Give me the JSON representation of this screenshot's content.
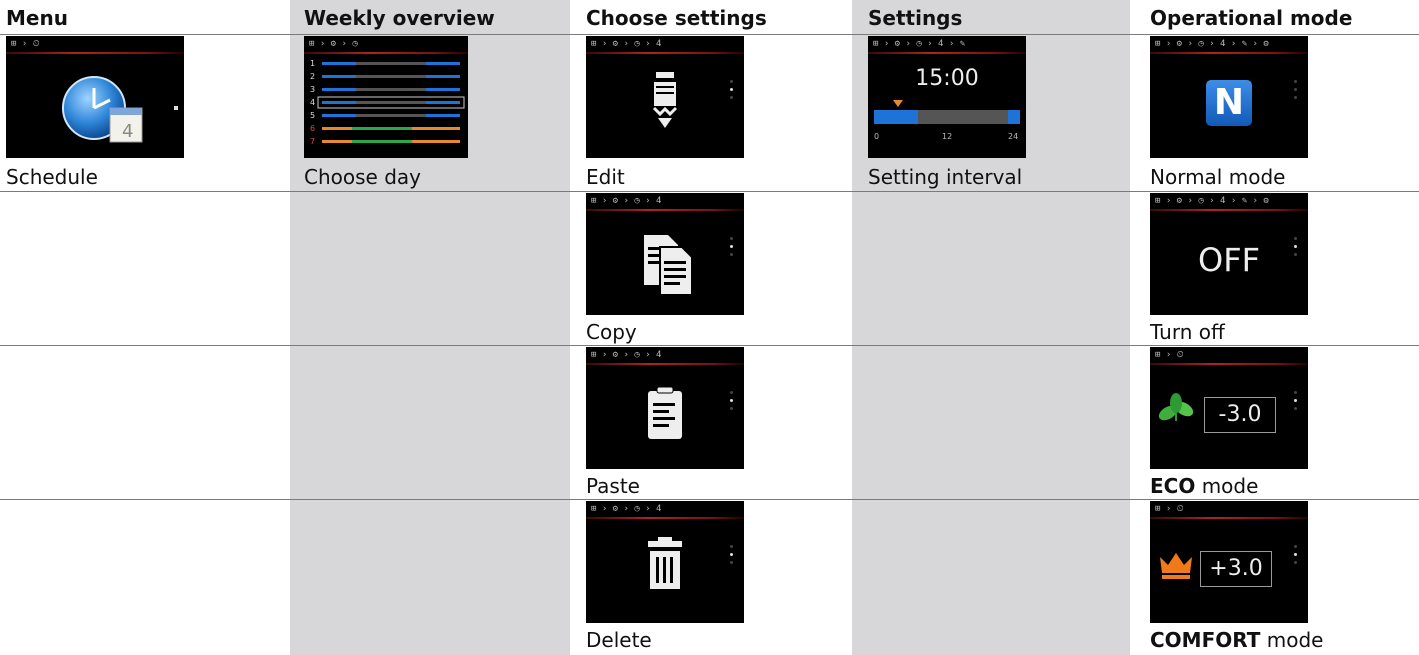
{
  "headers": {
    "menu": "Menu",
    "weekly": "Weekly overview",
    "choose": "Choose settings",
    "settings": "Settings",
    "mode": "Operational mode"
  },
  "captions": {
    "schedule": "Schedule",
    "choose_day": "Choose day",
    "edit": "Edit",
    "setting_interval": "Setting interval",
    "normal_mode": "Normal mode",
    "copy": "Copy",
    "turn_off": "Turn off",
    "paste": "Paste",
    "eco_bold": "ECO",
    "eco_rest": " mode",
    "delete": "Delete",
    "comfort_bold": "COMFORT",
    "comfort_rest": " mode"
  },
  "screens": {
    "crumb_menu": "⊞ › ⏲",
    "crumb_weekly": "⊞ › ⚙ › ◷",
    "crumb_choose": "⊞ › ⚙ › ◷ › 4",
    "crumb_settings": "⊞ › ⚙ › ◷ › 4 › ✎",
    "crumb_mode": "⊞ › ⚙ › ◷ › 4 › ✎ › ⚙",
    "day_numbers": [
      "1",
      "2",
      "3",
      "4",
      "5",
      "6",
      "7"
    ],
    "time": "15:00",
    "axis_ticks": [
      "0",
      "12",
      "24"
    ],
    "normal_letter": "N",
    "off_text": "OFF",
    "eco_value": "-3.0",
    "comfort_value": "+3.0"
  },
  "colors": {
    "accent_red": "#b22222",
    "bar_blue": "#1e73d8",
    "bar_orange": "#e8892b",
    "bar_green": "#2aa84a",
    "shade": "#d7d7d9"
  }
}
